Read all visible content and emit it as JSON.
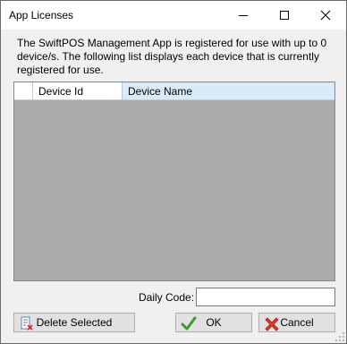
{
  "window": {
    "title": "App Licenses"
  },
  "description": "The SwiftPOS Management App is registered for use with up to 0 device/s.  The following list displays each device that is currently registered for use.",
  "grid": {
    "columns": [
      "Device Id",
      "Device Name"
    ],
    "rows": []
  },
  "daily_code": {
    "label": "Daily Code:",
    "value": ""
  },
  "buttons": {
    "delete_selected": "Delete Selected",
    "ok": "OK",
    "cancel": "Cancel"
  },
  "colors": {
    "grid_empty_bg": "#ababab",
    "selected_header_bg": "#d9ebf9",
    "button_face": "#e1e1e1"
  },
  "icons": {
    "minimize": "minimize-icon",
    "maximize": "maximize-icon",
    "close": "close-icon",
    "delete": "delete-list-icon",
    "ok": "checkmark-icon",
    "cancel": "cancel-x-icon"
  }
}
